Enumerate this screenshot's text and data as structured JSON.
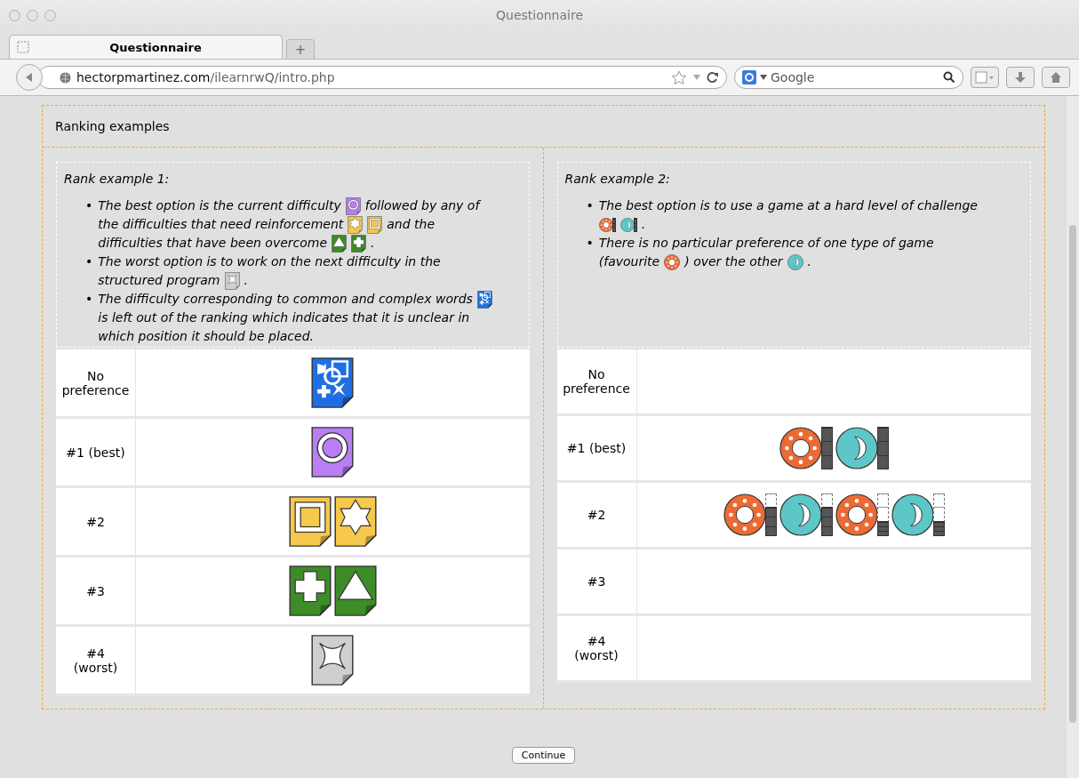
{
  "window": {
    "title": "Questionnaire"
  },
  "tabs": [
    {
      "label": "Questionnaire",
      "selected": true
    }
  ],
  "new_tab": "+",
  "address": {
    "host": "hectorpmartinez.com",
    "path": "/ilearnrwQ/intro.php"
  },
  "search": {
    "placeholder": "Google"
  },
  "panel": {
    "title": "Ranking examples",
    "examples": [
      {
        "title": "Rank example 1:",
        "bullets": [
          {
            "marker": "•",
            "lines": [
              [
                {
                  "kind": "text",
                  "text": "The best option is the current difficulty"
                },
                {
                  "kind": "circle-card",
                  "color": "#b97ef2"
                },
                {
                  "kind": "text",
                  "text": "followed by any of"
                }
              ],
              [
                {
                  "kind": "text",
                  "text": "the difficulties that need reinforcement"
                },
                {
                  "kind": "star-card",
                  "color": "#f6c94c"
                },
                {
                  "kind": "square-card",
                  "color": "#f6c94c"
                },
                {
                  "kind": "text",
                  "text": "and the"
                }
              ],
              [
                {
                  "kind": "text",
                  "text": "difficulties that have been overcome"
                },
                {
                  "kind": "triangle-card",
                  "color": "#3d8c27"
                },
                {
                  "kind": "plus-card",
                  "color": "#3d8c27"
                },
                {
                  "kind": "text",
                  "text": "."
                }
              ]
            ]
          },
          {
            "marker": "•",
            "lines": [
              [
                {
                  "kind": "text",
                  "text": "The worst option is to work on the next difficulty in the"
                }
              ],
              [
                {
                  "kind": "text",
                  "text": "structured program"
                },
                {
                  "kind": "sparkle-card",
                  "color": "#cfcfcf"
                },
                {
                  "kind": "text",
                  "text": "."
                }
              ]
            ]
          },
          {
            "marker": "•",
            "lines": [
              [
                {
                  "kind": "text",
                  "text": "The difficulty corresponding to common and complex words"
                },
                {
                  "kind": "mixed-card",
                  "color": "#1e6fe3"
                }
              ],
              [
                {
                  "kind": "text",
                  "text": "is left out of the ranking which indicates that it is unclear in"
                }
              ],
              [
                {
                  "kind": "text",
                  "text": "which position it should be placed."
                }
              ]
            ]
          }
        ],
        "rows": [
          {
            "label": "No\npreference",
            "items": [
              {
                "kind": "mixed-card",
                "color": "#1e6fe3"
              }
            ]
          },
          {
            "label": "#1 (best)",
            "items": [
              {
                "kind": "circle-card",
                "color": "#b97ef2"
              }
            ]
          },
          {
            "label": "#2",
            "items": [
              {
                "kind": "square-card",
                "color": "#f6c94c"
              },
              {
                "kind": "star-card",
                "color": "#f6c94c"
              }
            ]
          },
          {
            "label": "#3",
            "items": [
              {
                "kind": "plus-card",
                "color": "#3d8c27"
              },
              {
                "kind": "triangle-card",
                "color": "#3d8c27"
              }
            ]
          },
          {
            "label": "#4\n(worst)",
            "items": [
              {
                "kind": "sparkle-card",
                "color": "#cfcfcf"
              }
            ]
          }
        ]
      },
      {
        "title": "Rank example 2:",
        "bullets": [
          {
            "marker": "•",
            "lines": [
              [
                {
                  "kind": "text",
                  "text": "The best option is to use a game at a hard level of challenge"
                }
              ],
              [
                {
                  "kind": "sun-game",
                  "color": "#ec6b34",
                  "level": 1
                },
                {
                  "kind": "moon-game",
                  "color": "#5cc6c8",
                  "level": 1
                },
                {
                  "kind": "text",
                  "text": "."
                }
              ]
            ]
          },
          {
            "marker": "•",
            "lines": [
              [
                {
                  "kind": "text",
                  "text": "There is no particular preference of one type of game"
                }
              ],
              [
                {
                  "kind": "text",
                  "text": "(favourite"
                },
                {
                  "kind": "sun-token",
                  "color": "#ec6b34"
                },
                {
                  "kind": "text",
                  "text": ") over the other"
                },
                {
                  "kind": "moon-token",
                  "color": "#5cc6c8"
                },
                {
                  "kind": "text",
                  "text": "."
                }
              ]
            ]
          }
        ],
        "rows": [
          {
            "label": "No\npreference",
            "items": []
          },
          {
            "label": "#1 (best)",
            "items": [
              {
                "kind": "sun-game",
                "color": "#ec6b34",
                "level": 1
              },
              {
                "kind": "moon-game",
                "color": "#5cc6c8",
                "level": 1
              }
            ]
          },
          {
            "label": "#2",
            "items": [
              {
                "kind": "sun-game",
                "color": "#ec6b34",
                "level": 0.67
              },
              {
                "kind": "moon-game",
                "color": "#5cc6c8",
                "level": 0.67
              },
              {
                "kind": "sun-game",
                "color": "#ec6b34",
                "level": 0.33
              },
              {
                "kind": "moon-game",
                "color": "#5cc6c8",
                "level": 0.33
              }
            ]
          },
          {
            "label": "#3",
            "items": []
          },
          {
            "label": "#4\n(worst)",
            "items": []
          }
        ]
      }
    ]
  },
  "continue_button": "Continue"
}
